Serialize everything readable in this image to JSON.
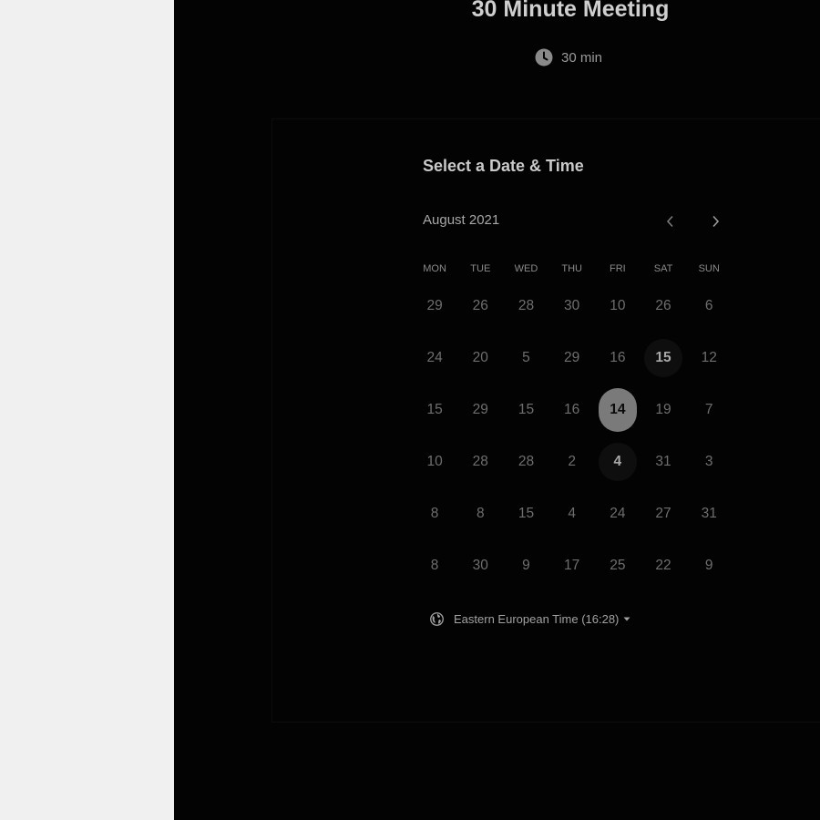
{
  "event": {
    "title": "30 Minute Meeting",
    "duration": "30 min",
    "duration_icon": "clock-icon"
  },
  "calendar": {
    "heading": "Select a Date & Time",
    "month": "August 2021",
    "prev_icon": "chevron-left-icon",
    "next_icon": "chevron-right-icon",
    "weekdays": [
      "MON",
      "TUE",
      "WED",
      "THU",
      "FRI",
      "SAT",
      "SUN"
    ],
    "weeks": [
      [
        "29",
        "26",
        "28",
        "30",
        "10",
        "26",
        "6"
      ],
      [
        "24",
        "20",
        "5",
        "29",
        "16",
        "15",
        "12"
      ],
      [
        "15",
        "29",
        "15",
        "16",
        "14",
        "19",
        "7"
      ],
      [
        "10",
        "28",
        "28",
        "2",
        "4",
        "31",
        "3"
      ],
      [
        "8",
        "8",
        "15",
        "4",
        "24",
        "27",
        "31"
      ],
      [
        "8",
        "30",
        "9",
        "17",
        "25",
        "22",
        "9"
      ]
    ],
    "available_days": [
      {
        "week": 1,
        "day": 5
      },
      {
        "week": 3,
        "day": 4
      }
    ],
    "selected_day": {
      "week": 2,
      "day": 4
    }
  },
  "timezone": {
    "label": "Eastern European Time (16:28)",
    "icon": "globe-icon",
    "dropdown_icon": "caret-down-icon"
  },
  "colors": {
    "page_background": "#f0f0f0",
    "overlay_background": "#030303",
    "selected_day": "#7a7a7a"
  }
}
